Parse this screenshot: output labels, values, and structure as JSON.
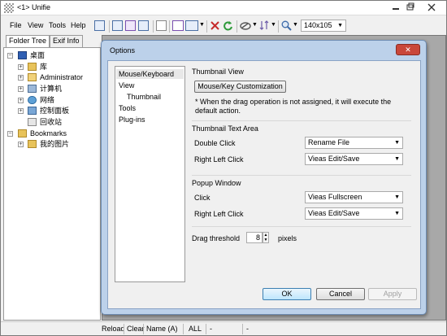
{
  "window": {
    "title": "<1> Unifie"
  },
  "menu": {
    "items": [
      "File",
      "View",
      "Tools",
      "Help"
    ]
  },
  "toolbar": {
    "thumb_size": "140x105"
  },
  "left_tabs": [
    "Folder Tree",
    "Exif Info"
  ],
  "tree": [
    {
      "label": "桌面",
      "icon": "desktop-icon"
    },
    {
      "label": "库",
      "icon": "folder-icon"
    },
    {
      "label": "Administrator",
      "icon": "user-folder-icon"
    },
    {
      "label": "计算机",
      "icon": "computer-icon"
    },
    {
      "label": "网络",
      "icon": "network-icon"
    },
    {
      "label": "控制面板",
      "icon": "control-panel-icon"
    },
    {
      "label": "回收站",
      "icon": "recycle-bin-icon"
    },
    {
      "label": "Bookmarks",
      "icon": "folder-icon"
    },
    {
      "label": "我的图片",
      "icon": "folder-icon"
    }
  ],
  "status": {
    "reload": "Reload",
    "clear": "Clear",
    "sort": "Name (A)",
    "filter": "ALL",
    "dash1": "-",
    "dash2": "-"
  },
  "dialog": {
    "title": "Options",
    "close": "✕",
    "categories": [
      "Mouse/Keyboard",
      "View",
      "Thumbnail",
      "Tools",
      "Plug-ins"
    ],
    "thumbnail_view": {
      "title": "Thumbnail View",
      "button": "Mouse/Key Customization",
      "note": "* When the drag operation is not assigned, it will execute the default action."
    },
    "thumbnail_text": {
      "title": "Thumbnail Text Area",
      "double_click_label": "Double Click",
      "double_click_value": "Rename File",
      "right_left_label": "Right  Left Click",
      "right_left_value": "Vieas Edit/Save"
    },
    "popup": {
      "title": "Popup Window",
      "click_label": "Click",
      "click_value": "Vieas Fullscreen",
      "right_left_label": "Right  Left Click",
      "right_left_value": "Vieas Edit/Save"
    },
    "drag": {
      "label": "Drag threshold",
      "value": "8",
      "unit": "pixels"
    },
    "buttons": {
      "ok": "OK",
      "cancel": "Cancel",
      "apply": "Apply"
    }
  }
}
